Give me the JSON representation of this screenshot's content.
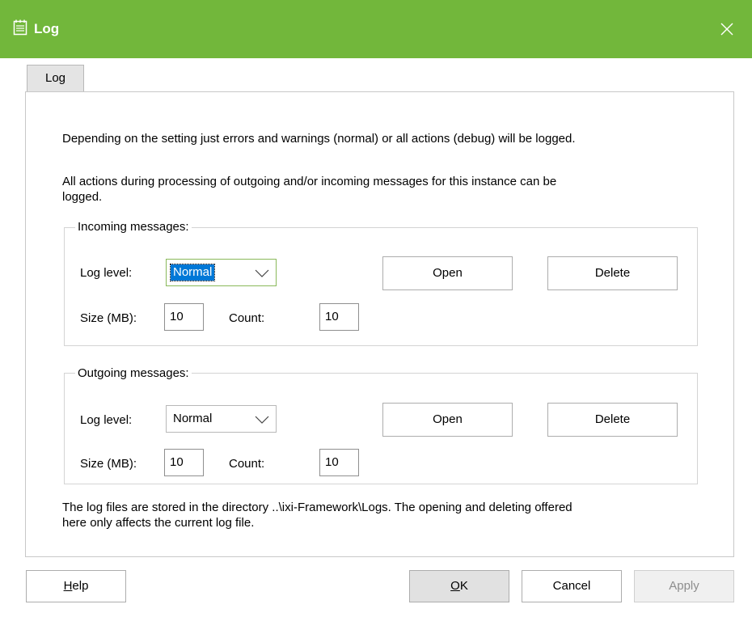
{
  "window": {
    "title": "Log",
    "title_icon": "notepad-icon",
    "close_icon": "close-icon",
    "accent_color": "#72b73b"
  },
  "tabs": [
    {
      "label": "Log",
      "selected": true
    }
  ],
  "description": {
    "line1": "Depending on the setting just errors and warnings (normal) or all actions (debug) will be logged.",
    "line2a": "All actions during processing of outgoing and/or incoming messages for this instance can be",
    "line2b": "logged."
  },
  "incoming": {
    "legend": "Incoming messages:",
    "log_level_label": "Log level:",
    "log_level_value": "Normal",
    "open_label": "Open",
    "delete_label": "Delete",
    "size_label": "Size (MB):",
    "size_value": "10",
    "count_label": "Count:",
    "count_value": "10"
  },
  "outgoing": {
    "legend": "Outgoing messages:",
    "log_level_label": "Log level:",
    "log_level_value": "Normal",
    "open_label": "Open",
    "delete_label": "Delete",
    "size_label": "Size (MB):",
    "size_value": "10",
    "count_label": "Count:",
    "count_value": "10"
  },
  "footer_note": {
    "line1": "The log files are stored in the directory ..\\ixi-Framework\\Logs. The opening and deleting offered",
    "line2": "here only affects the current log file."
  },
  "buttons": {
    "help_first": "H",
    "help_rest": "elp",
    "ok_first": "O",
    "ok_rest": "K",
    "cancel": "Cancel",
    "apply": "Apply"
  }
}
